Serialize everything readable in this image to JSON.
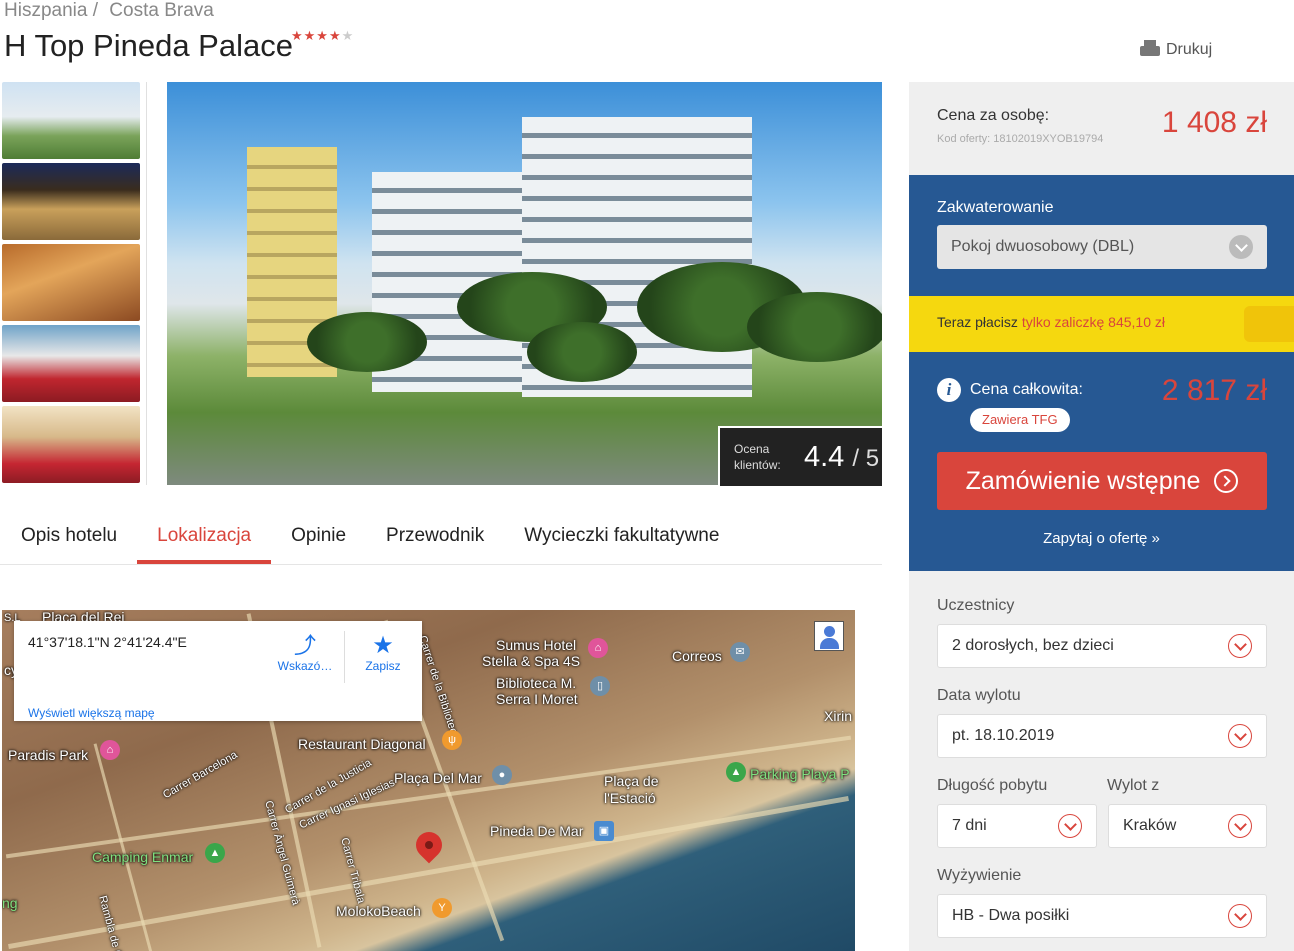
{
  "breadcrumb": [
    "Hiszpania /",
    "Costa Brava"
  ],
  "hotel": {
    "name": "H Top Pineda Palace",
    "stars_filled": "★★★★",
    "stars_empty": "★"
  },
  "print_label": "Drukuj",
  "rating": {
    "label": "Ocena klientów:",
    "value": "4.4",
    "max": "/ 5"
  },
  "tabs": [
    "Opis hotelu",
    "Lokalizacja",
    "Opinie",
    "Przewodnik",
    "Wycieczki fakultatywne"
  ],
  "map": {
    "coords": "41°37'18.1\"N 2°41'24.4\"E",
    "directions_label": "Wskazó…",
    "save_label": "Zapisz",
    "larger_map_link": "Wyświetl większą mapę",
    "places": {
      "placa_del_rei": "Placa del Rei",
      "sl": "S.L",
      "sumus": "Sumus Hotel",
      "stella": "Stella & Spa 4S",
      "biblioteca1": "Biblioteca M.",
      "biblioteca2": "Serra I Moret",
      "correos": "Correos",
      "xirin": "Xirin",
      "carrer_biblioteca": "Carrer de la Biblioteca",
      "paradis": "Paradis Park",
      "restaurant": "Restaurant Diagonal",
      "carrer_barcelona": "Carrer Barcelona",
      "carrer_justicia": "Carrer de la Justicia",
      "placa_mar": "Plaça Del Mar",
      "placa_estacio1": "Plaça de",
      "placa_estacio2": "l'Estació",
      "parking": "Parking Playa P",
      "carrer_iglesias": "Carrer Ignasi Iglesias",
      "carrer_guimera": "Carrer Àngel Guimerà",
      "carrer_tribala": "Carrer Tribala",
      "pineda_mar": "Pineda De Mar",
      "camping": "Camping Enmar",
      "moloko": "MolokoBeach",
      "rambla": "Rambla de C",
      "cy": "cy",
      "ng": "ng"
    }
  },
  "booking": {
    "price_per_person_label": "Cena za osobę:",
    "offer_code": "Kod oferty: 18102019XYOB19794",
    "price_per_person": "1 408 zł",
    "accommodation_label": "Zakwaterowanie",
    "accommodation_value": "Pokoj dwuosobowy (DBL)",
    "deposit_prefix": "Teraz płacisz ",
    "deposit_highlight": "tylko zaliczkę 845,10 zł",
    "total_label": "Cena całkowita:",
    "tfg_badge": "Zawiera TFG",
    "total_price": "2 817 zł",
    "order_button": "Zamówienie wstępne",
    "ask_link": "Zapytaj o ofertę »",
    "participants_label": "Uczestnicy",
    "participants_value": "2 dorosłych, bez dzieci",
    "departure_label": "Data wylotu",
    "departure_value": "pt. 18.10.2019",
    "duration_label": "Długość pobytu",
    "duration_value": "7 dni",
    "from_label": "Wylot z",
    "from_value": "Kraków",
    "board_label": "Wyżywienie",
    "board_value": "HB - Dwa posiłki"
  },
  "colors": {
    "accent": "#d9453c",
    "panel_blue": "#265893",
    "deposit_yellow": "#f5d80f"
  }
}
